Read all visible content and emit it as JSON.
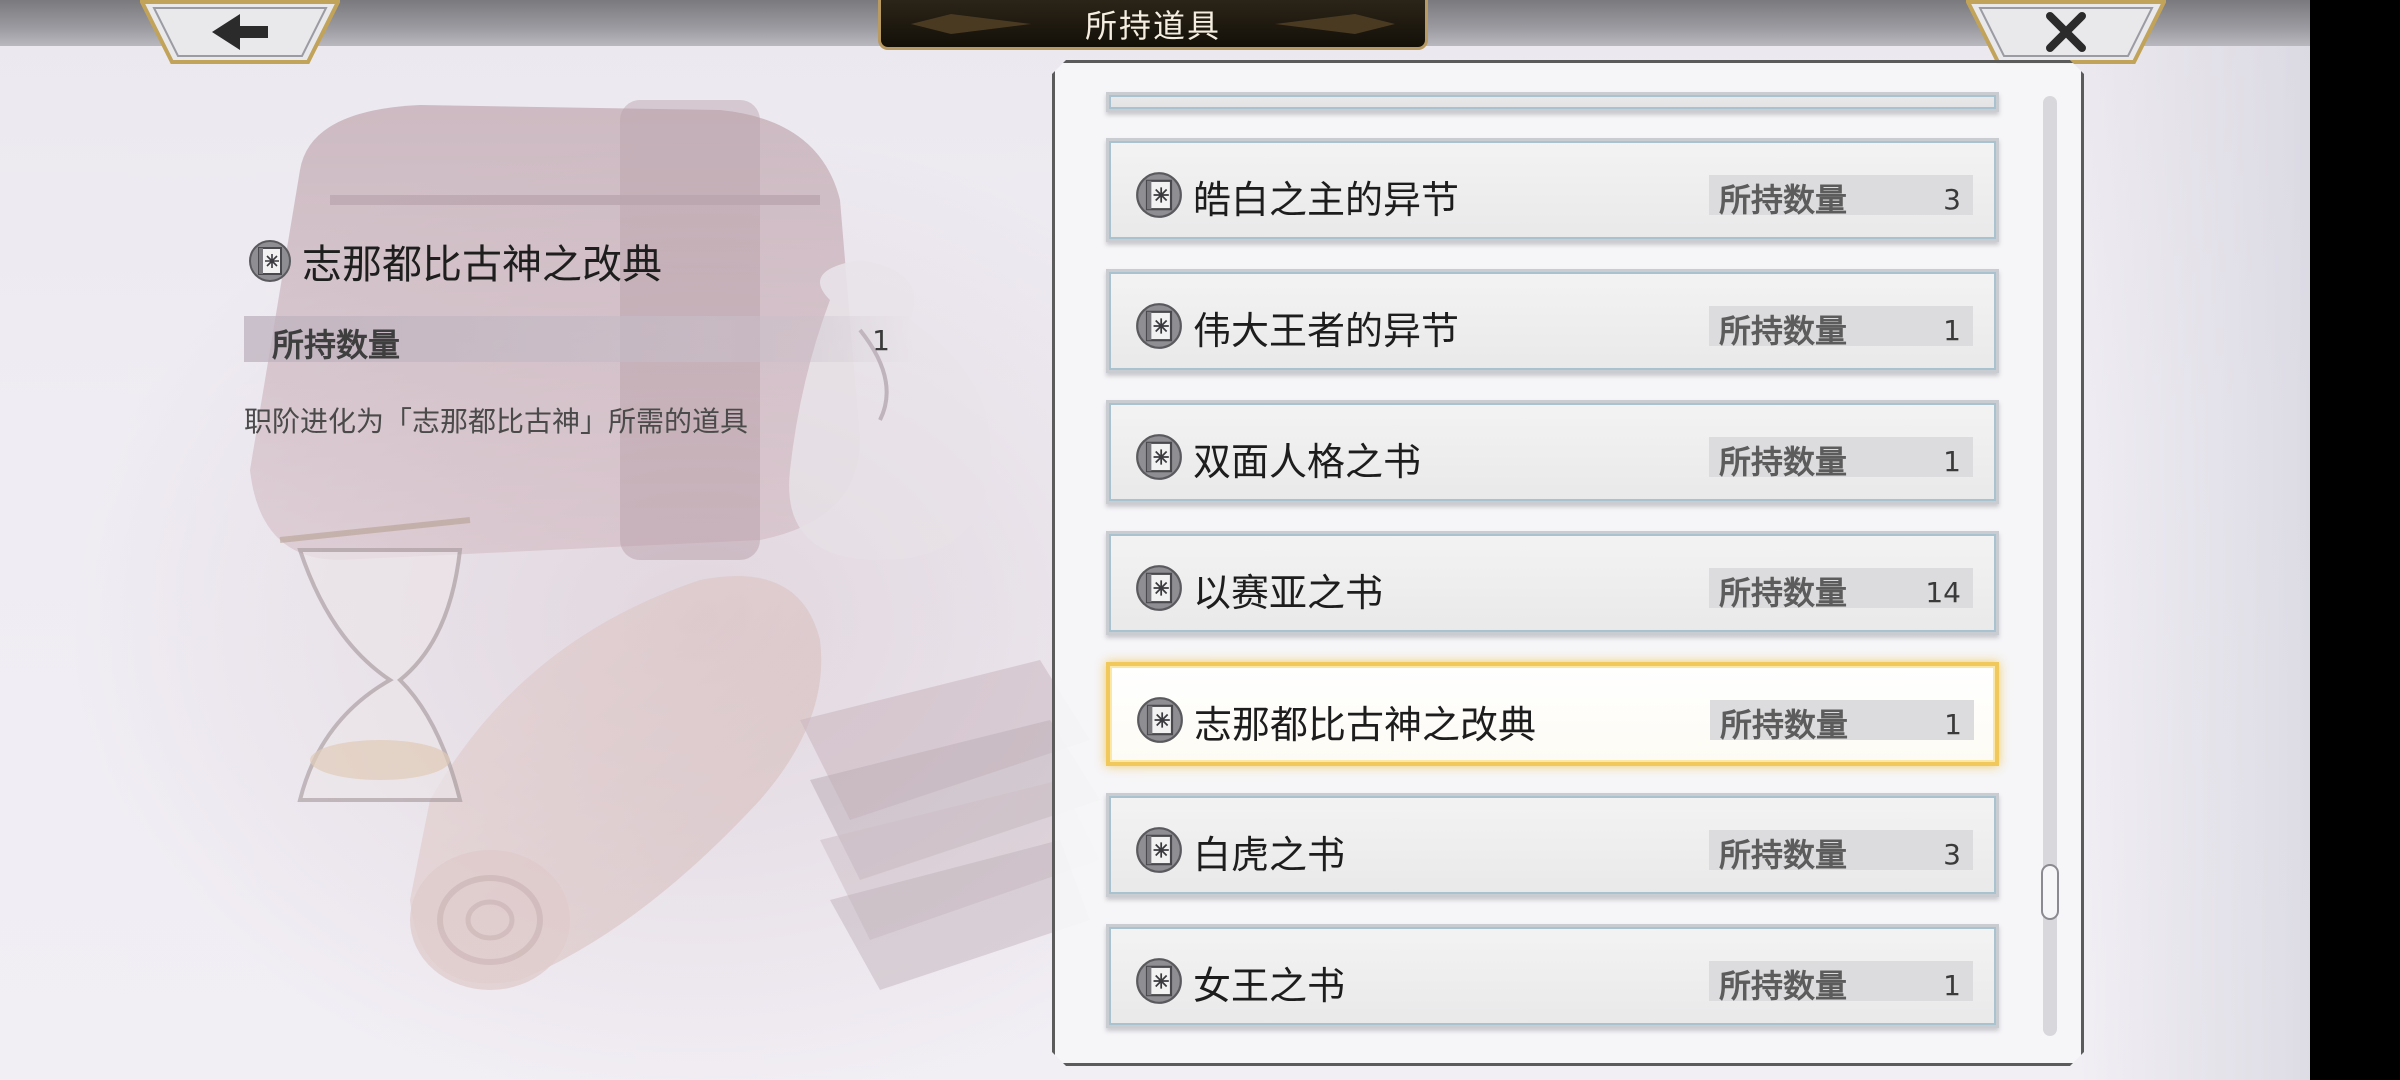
{
  "header": {
    "title": "所持道具",
    "back_icon": "arrow-left-icon",
    "close_icon": "close-x-icon"
  },
  "detail": {
    "name": "志那都比古神之改典",
    "icon": "book-icon",
    "qty_label": "所持数量",
    "qty_value": "1",
    "description": "职阶进化为「志那都比古神」所需的道具"
  },
  "list": {
    "items": [
      {
        "name": "皓白之主的异节",
        "qty_label": "所持数量",
        "qty": "3",
        "icon": "book-icon"
      },
      {
        "name": "伟大王者的异节",
        "qty_label": "所持数量",
        "qty": "1",
        "icon": "book-icon"
      },
      {
        "name": "双面人格之书",
        "qty_label": "所持数量",
        "qty": "1",
        "icon": "book-icon"
      },
      {
        "name": "以赛亚之书",
        "qty_label": "所持数量",
        "qty": "14",
        "icon": "book-icon"
      },
      {
        "name": "志那都比古神之改典",
        "qty_label": "所持数量",
        "qty": "1",
        "icon": "book-icon",
        "selected": true
      },
      {
        "name": "白虎之书",
        "qty_label": "所持数量",
        "qty": "3",
        "icon": "book-icon"
      },
      {
        "name": "女王之书",
        "qty_label": "所持数量",
        "qty": "1",
        "icon": "book-icon"
      }
    ]
  },
  "colors": {
    "selected_border": "#f0c85c",
    "title_plate": "#141008",
    "title_plate_border": "#b89a62"
  }
}
